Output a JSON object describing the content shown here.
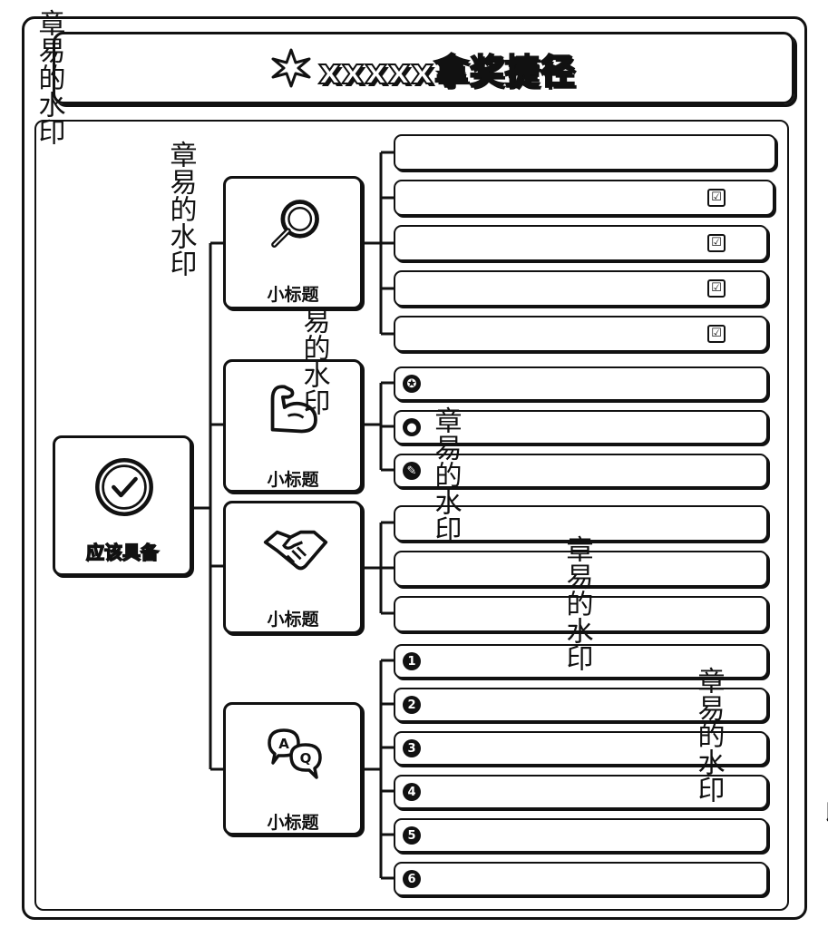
{
  "title": {
    "text": "xxxxx拿奖捷径",
    "icon": "sparkle-star-icon"
  },
  "root": {
    "label": "应该具备",
    "icon": "check-circle-icon"
  },
  "branches": [
    {
      "label": "小标题",
      "icon": "magnifier-icon"
    },
    {
      "label": "小标题",
      "icon": "flexed-arm-icon"
    },
    {
      "label": "小标题",
      "icon": "handshake-icon"
    },
    {
      "label": "小标题",
      "icon": "qa-bubbles-icon"
    }
  ],
  "leaf_icons": {
    "group2": [
      "✪",
      "●",
      "✎"
    ],
    "group4": [
      "1",
      "2",
      "3",
      "4",
      "5",
      "6"
    ],
    "check": "☑"
  },
  "watermarks": [
    "章易的水印",
    "章易的水印",
    "易的水印",
    "章易的水印",
    "章易的水印",
    "章易的水印",
    "章易的水印"
  ]
}
